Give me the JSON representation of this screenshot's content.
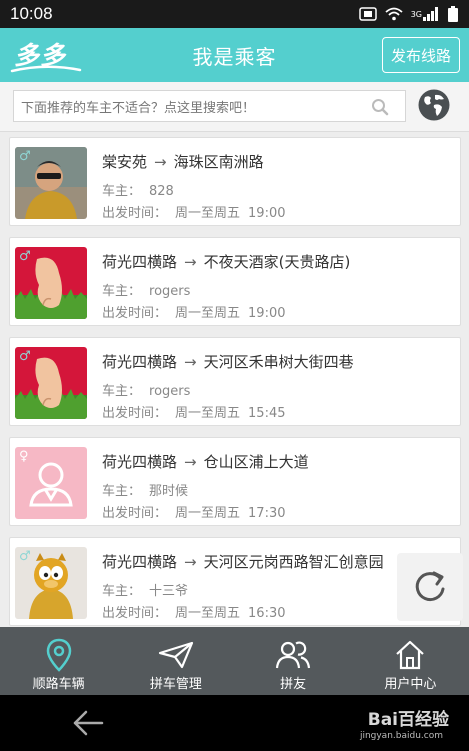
{
  "status_bar": {
    "time": "10:08",
    "network": "3G"
  },
  "header": {
    "logo": "多多",
    "title": "我是乘客",
    "publish_label": "发布线路"
  },
  "search": {
    "placeholder": "下面推荐的车主不适合？点这里搜索吧！"
  },
  "rides": [
    {
      "gender": "♂",
      "from": "棠安苑",
      "to": "海珠区南洲路",
      "driver_label": "车主：",
      "driver": "828",
      "depart_label": "出发时间：",
      "days": "周一至周五",
      "time": "19:00",
      "avatar": "photo-man"
    },
    {
      "gender": "♂",
      "from": "荷光四横路",
      "to": "不夜天酒家(天贵路店)",
      "driver_label": "车主：",
      "driver": "rogers",
      "depart_label": "出发时间：",
      "days": "周一至周五",
      "time": "19:00",
      "avatar": "photo-hand"
    },
    {
      "gender": "♂",
      "from": "荷光四横路",
      "to": "天河区禾串树大街四巷",
      "driver_label": "车主：",
      "driver": "rogers",
      "depart_label": "出发时间：",
      "days": "周一至周五",
      "time": "15:45",
      "avatar": "photo-hand"
    },
    {
      "gender": "♀",
      "from": "荷光四横路",
      "to": "仓山区浦上大道",
      "driver_label": "车主：",
      "driver": "那时候",
      "depart_label": "出发时间：",
      "days": "周一至周五",
      "time": "17:30",
      "avatar": "default-female"
    },
    {
      "gender": "♂",
      "from": "荷光四横路",
      "to": "天河区元岗西路智汇创意园",
      "driver_label": "车主：",
      "driver": "十三爷",
      "depart_label": "出发时间：",
      "days": "周一至周五",
      "time": "16:30",
      "avatar": "photo-garfield"
    }
  ],
  "tabs": [
    {
      "label": "顺路车辆",
      "icon": "location-pin-icon",
      "active": true
    },
    {
      "label": "拼车管理",
      "icon": "paper-plane-icon",
      "active": false
    },
    {
      "label": "拼友",
      "icon": "friends-icon",
      "active": false
    },
    {
      "label": "用户中心",
      "icon": "home-icon",
      "active": false
    }
  ],
  "watermark": {
    "brand": "Bai百经验",
    "site": "jingyan.baidu.com"
  },
  "colors": {
    "accent": "#54cfce",
    "tabbar": "#54595c",
    "male": "#6fc9c8",
    "female": "#f1a1b4"
  }
}
